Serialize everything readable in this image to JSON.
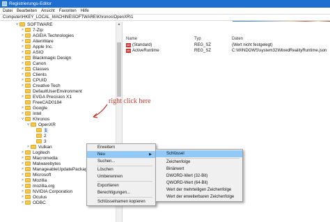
{
  "window": {
    "title": "Registrierungs-Editor"
  },
  "menu": [
    "Datei",
    "Bearbeiten",
    "Ansicht",
    "Favoriten",
    "Hilfe"
  ],
  "address": "Computer\\HKEY_LOCAL_MACHINE\\SOFTWARE\\Khronos\\OpenXR\\1",
  "tree": [
    {
      "label": "SOFTWARE",
      "exp": "v"
    },
    {
      "label": "7-Zip",
      "exp": ">"
    },
    {
      "label": "AGEIA Technologies",
      "exp": ">"
    },
    {
      "label": "AlienWare",
      "exp": ">"
    },
    {
      "label": "Apple Inc.",
      "exp": ">"
    },
    {
      "label": "ASIO",
      "exp": ">"
    },
    {
      "label": "Blackmagic Design",
      "exp": ">"
    },
    {
      "label": "Canon",
      "exp": ">"
    },
    {
      "label": "Classes",
      "exp": ">"
    },
    {
      "label": "Clients",
      "exp": ">"
    },
    {
      "label": "CPUID",
      "exp": ">"
    },
    {
      "label": "Creative Tech",
      "exp": ">"
    },
    {
      "label": "DefaultUserEnvironment",
      "exp": ""
    },
    {
      "label": "EVGA Precision X1",
      "exp": ">"
    },
    {
      "label": "FreeCAD0184",
      "exp": ""
    },
    {
      "label": "Google",
      "exp": ">"
    },
    {
      "label": "Intel",
      "exp": ">"
    },
    {
      "label": "Khronos",
      "exp": "v"
    },
    {
      "label": "OpenXR",
      "exp": "v"
    },
    {
      "label": "1",
      "exp": ""
    },
    {
      "label": "2",
      "exp": ""
    },
    {
      "label": "3",
      "exp": ""
    },
    {
      "label": "Vulkan",
      "exp": ">"
    },
    {
      "label": "Logitech",
      "exp": ">"
    },
    {
      "label": "Macromedia",
      "exp": ">"
    },
    {
      "label": "Malwarebytes",
      "exp": ">"
    },
    {
      "label": "ManageableUpdatePackage",
      "exp": ">"
    },
    {
      "label": "Microsoft",
      "exp": ">"
    },
    {
      "label": "Mozilla",
      "exp": ">"
    },
    {
      "label": "mozilla.org",
      "exp": ">"
    },
    {
      "label": "NVIDIA Corporation",
      "exp": ">"
    },
    {
      "label": "Oculus",
      "exp": ">"
    },
    {
      "label": "ODBC",
      "exp": ">"
    }
  ],
  "values_headers": {
    "name": "Name",
    "type": "Typ",
    "data": "Daten"
  },
  "values": [
    {
      "name": "(Standard)",
      "type": "REG_SZ",
      "data": "(Wert nicht festgelegt)"
    },
    {
      "name": "ActiveRuntime",
      "type": "REG_SZ",
      "data": "C:\\WINDOWS\\system32\\MixedRealityRuntime.json"
    }
  ],
  "annotation": "right click here",
  "context_menu": [
    {
      "label": "Erweitern"
    },
    {
      "label": "Neu",
      "submenu": true
    },
    {
      "label": "Suchen..."
    },
    {
      "label": "Löschen"
    },
    {
      "label": "Umbenennen"
    },
    {
      "label": "Exportieren"
    },
    {
      "label": "Berechtigungen..."
    },
    {
      "label": "Schlüsselnamen kopieren"
    }
  ],
  "submenu": [
    {
      "label": "Schlüssel"
    },
    {
      "label": "Zeichenfolge"
    },
    {
      "label": "Binärwert"
    },
    {
      "label": "DWORD-Wert (32-Bit)"
    },
    {
      "label": "QWORD-Wert (64-Bit)"
    },
    {
      "label": "Wert der mehrteiligen Zeichenfolge"
    },
    {
      "label": "Wert der erweiterbaren Zeichenfolge"
    }
  ],
  "colors": {
    "accent": "#1f6fd1",
    "highlight": "#91c9f7",
    "annotation": "#c0392b"
  }
}
